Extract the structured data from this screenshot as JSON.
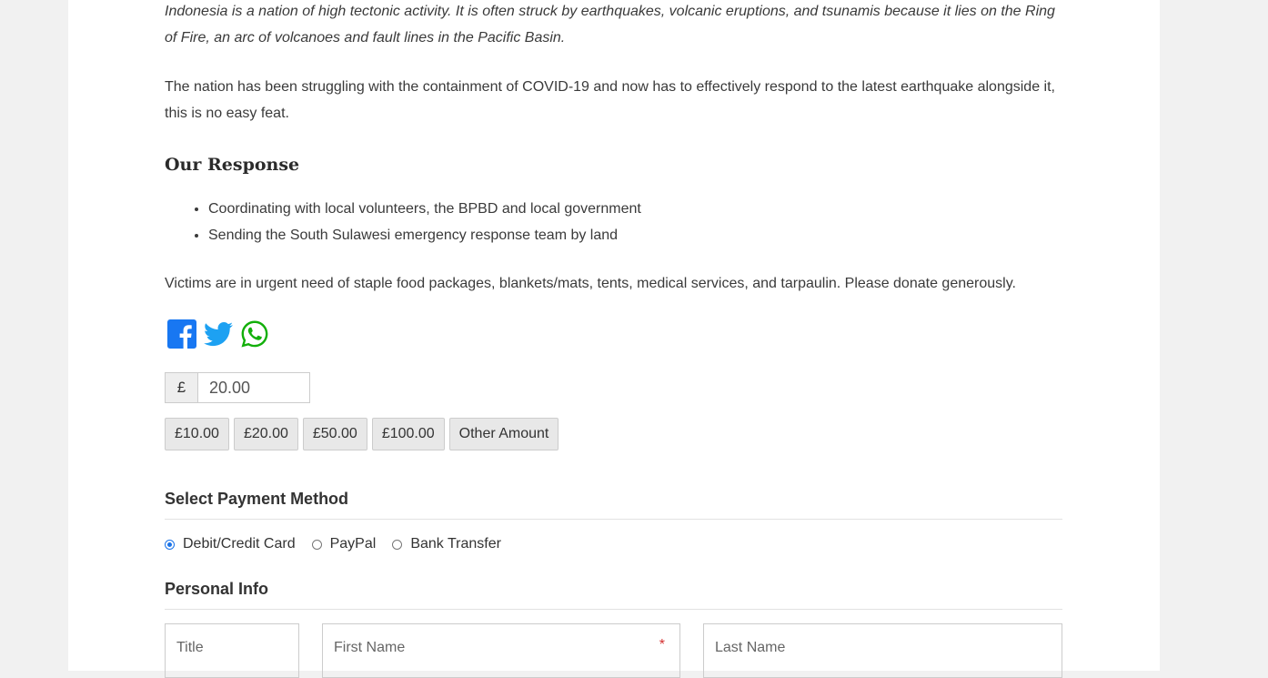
{
  "article": {
    "intro": "Indonesia is a nation of high tectonic activity. It is often struck by earthquakes, volcanic eruptions, and tsunamis because it lies on the Ring of Fire, an arc of volcanoes and fault lines in the Pacific Basin.",
    "paragraph2": "The nation has been struggling with the containment of COVID-19 and now has to effectively respond to the latest earthquake alongside it, this is no easy feat.",
    "response_heading": "Our Response",
    "response_items": [
      "Coordinating with local volunteers, the BPBD and local government",
      "Sending the South Sulawesi emergency response team by land"
    ],
    "paragraph3": "Victims are in urgent need of staple food packages, blankets/mats, tents, medical services, and tarpaulin. Please donate generously."
  },
  "share": {
    "icons": [
      "facebook-icon",
      "twitter-icon",
      "whatsapp-icon"
    ],
    "colors": {
      "facebook": "#1877f2",
      "twitter": "#1da1f2",
      "whatsapp": "#12af0a"
    }
  },
  "donation": {
    "currency_symbol": "£",
    "amount": "20.00",
    "levels": [
      "£10.00",
      "£20.00",
      "£50.00",
      "£100.00",
      "Other Amount"
    ]
  },
  "payment": {
    "title": "Select Payment Method",
    "methods": [
      {
        "label": "Debit/Credit Card",
        "selected": true
      },
      {
        "label": "PayPal",
        "selected": false
      },
      {
        "label": "Bank Transfer",
        "selected": false
      }
    ],
    "accent_color": "#1a73e8"
  },
  "personal": {
    "title": "Personal Info",
    "fields": {
      "title_placeholder": "Title",
      "first_name_placeholder": "First Name",
      "first_name_required_mark": "*",
      "last_name_placeholder": "Last Name"
    }
  }
}
